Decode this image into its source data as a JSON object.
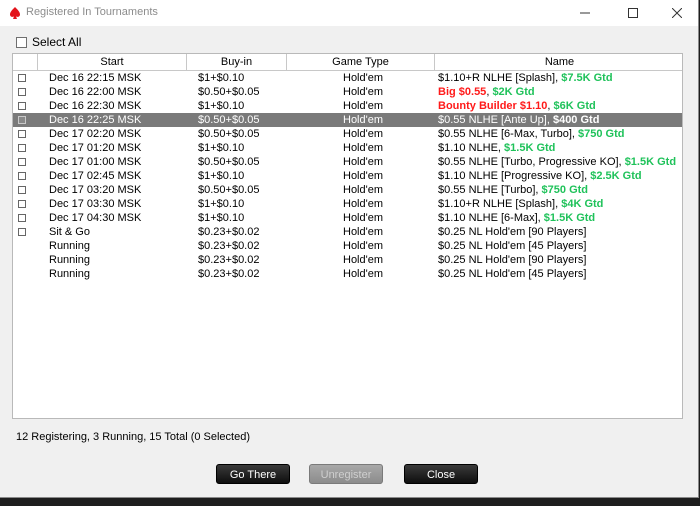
{
  "window": {
    "title": "Registered In Tournaments"
  },
  "select_all_label": "Select All",
  "columns": [
    "Start",
    "Buy-in",
    "Game Type",
    "Name"
  ],
  "rows": [
    {
      "checkbox": true,
      "start": "Dec 16  22:15 MSK",
      "buyin": "$1+$0.10",
      "game": "Hold'em",
      "name": [
        {
          "text": "$1.10+R NLHE [Splash], ",
          "style": "normal"
        },
        {
          "text": "$7.5K Gtd",
          "style": "green"
        }
      ]
    },
    {
      "checkbox": true,
      "start": "Dec 16  22:00 MSK",
      "buyin": "$0.50+$0.05",
      "game": "Hold'em",
      "name": [
        {
          "text": "Big $0.55",
          "style": "red"
        },
        {
          "text": ", ",
          "style": "normal"
        },
        {
          "text": "$2K Gtd",
          "style": "green"
        }
      ]
    },
    {
      "checkbox": true,
      "start": "Dec 16  22:30 MSK",
      "buyin": "$1+$0.10",
      "game": "Hold'em",
      "name": [
        {
          "text": "Bounty Builder $1.10",
          "style": "red"
        },
        {
          "text": ", ",
          "style": "normal"
        },
        {
          "text": "$6K Gtd",
          "style": "green"
        }
      ]
    },
    {
      "checkbox": true,
      "selected": true,
      "start": "Dec 16  22:25 MSK",
      "buyin": "$0.50+$0.05",
      "game": "Hold'em",
      "name": [
        {
          "text": "$0.55 NLHE [Ante Up], ",
          "style": "normal"
        },
        {
          "text": "$400 Gtd",
          "style": "bold"
        }
      ]
    },
    {
      "checkbox": true,
      "start": "Dec 17  02:20 MSK",
      "buyin": "$0.50+$0.05",
      "game": "Hold'em",
      "name": [
        {
          "text": "$0.55 NLHE [6-Max, Turbo], ",
          "style": "normal"
        },
        {
          "text": "$750 Gtd",
          "style": "green"
        }
      ]
    },
    {
      "checkbox": true,
      "start": "Dec 17  01:20 MSK",
      "buyin": "$1+$0.10",
      "game": "Hold'em",
      "name": [
        {
          "text": "$1.10 NLHE, ",
          "style": "normal"
        },
        {
          "text": "$1.5K Gtd",
          "style": "green"
        }
      ]
    },
    {
      "checkbox": true,
      "start": "Dec 17  01:00 MSK",
      "buyin": "$0.50+$0.05",
      "game": "Hold'em",
      "name": [
        {
          "text": "$0.55 NLHE [Turbo, Progressive KO], ",
          "style": "normal"
        },
        {
          "text": "$1.5K Gtd",
          "style": "green"
        }
      ]
    },
    {
      "checkbox": true,
      "start": "Dec 17  02:45 MSK",
      "buyin": "$1+$0.10",
      "game": "Hold'em",
      "name": [
        {
          "text": "$1.10 NLHE [Progressive KO], ",
          "style": "normal"
        },
        {
          "text": "$2.5K Gtd",
          "style": "green"
        }
      ]
    },
    {
      "checkbox": true,
      "start": "Dec 17  03:20 MSK",
      "buyin": "$0.50+$0.05",
      "game": "Hold'em",
      "name": [
        {
          "text": "$0.55 NLHE [Turbo], ",
          "style": "normal"
        },
        {
          "text": "$750 Gtd",
          "style": "green"
        }
      ]
    },
    {
      "checkbox": true,
      "start": "Dec 17  03:30 MSK",
      "buyin": "$1+$0.10",
      "game": "Hold'em",
      "name": [
        {
          "text": "$1.10+R NLHE [Splash], ",
          "style": "normal"
        },
        {
          "text": "$4K Gtd",
          "style": "green"
        }
      ]
    },
    {
      "checkbox": true,
      "start": "Dec 17  04:30 MSK",
      "buyin": "$1+$0.10",
      "game": "Hold'em",
      "name": [
        {
          "text": "$1.10 NLHE [6-Max], ",
          "style": "normal"
        },
        {
          "text": "$1.5K Gtd",
          "style": "green"
        }
      ]
    },
    {
      "checkbox": true,
      "start": "Sit & Go",
      "buyin": "$0.23+$0.02",
      "game": "Hold'em",
      "name": [
        {
          "text": "$0.25 NL Hold'em [90 Players]",
          "style": "normal"
        }
      ]
    },
    {
      "checkbox": false,
      "start": "Running",
      "buyin": "$0.23+$0.02",
      "game": "Hold'em",
      "name": [
        {
          "text": "$0.25 NL Hold'em [45 Players]",
          "style": "normal"
        }
      ]
    },
    {
      "checkbox": false,
      "start": "Running",
      "buyin": "$0.23+$0.02",
      "game": "Hold'em",
      "name": [
        {
          "text": "$0.25 NL Hold'em [90 Players]",
          "style": "normal"
        }
      ]
    },
    {
      "checkbox": false,
      "start": "Running",
      "buyin": "$0.23+$0.02",
      "game": "Hold'em",
      "name": [
        {
          "text": "$0.25 NL Hold'em [45 Players]",
          "style": "normal"
        }
      ]
    }
  ],
  "status": "12 Registering, 3 Running, 15 Total (0 Selected)",
  "buttons": {
    "go_there": "Go There",
    "unregister": "Unregister",
    "close": "Close"
  },
  "colors": {
    "highlight_red": "#ff1a1a",
    "highlight_green": "#1fc25a",
    "selected_row": "#7a7a7a"
  }
}
